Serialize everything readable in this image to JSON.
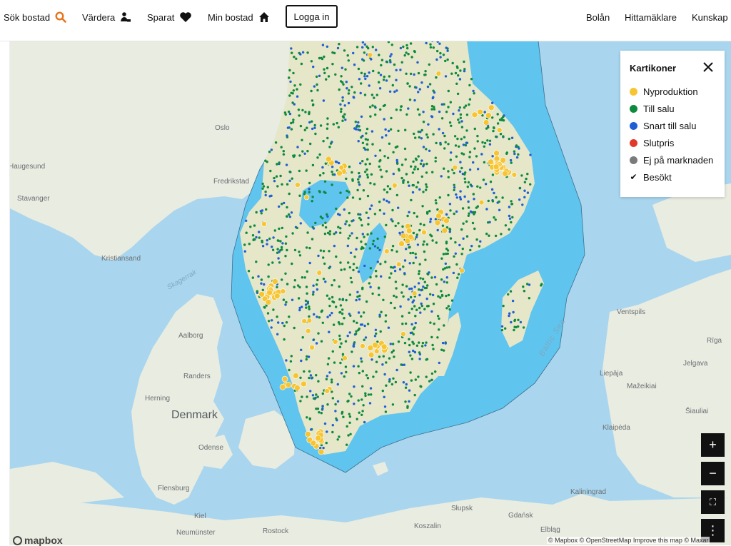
{
  "nav": {
    "items": [
      {
        "label": "Sök bostad",
        "icon": "search-icon"
      },
      {
        "label": "Värdera",
        "icon": "valuation-icon"
      },
      {
        "label": "Sparat",
        "icon": "heart-icon"
      },
      {
        "label": "Min bostad",
        "icon": "home-icon"
      }
    ],
    "login_label": "Logga in",
    "right_items": [
      "Bolån",
      "Hittamäklare",
      "Kunskap"
    ],
    "accent_color": "#e8741c"
  },
  "legend": {
    "title": "Kartikoner",
    "items": [
      {
        "label": "Nyproduktion",
        "color": "#f7c531"
      },
      {
        "label": "Till salu",
        "color": "#0d8a3d"
      },
      {
        "label": "Snart till salu",
        "color": "#1f5fd6"
      },
      {
        "label": "Slutpris",
        "color": "#e2392b"
      },
      {
        "label": "Ej på marknaden",
        "color": "#7a7a7a"
      },
      {
        "label": "Besökt",
        "icon": "check-icon"
      }
    ]
  },
  "map": {
    "places": [
      "Oslo",
      "Fredrikstad",
      "Stavanger",
      "Kristiansand",
      "Haugesund",
      "Aalborg",
      "Randers",
      "Herning",
      "Odense",
      "Flensburg",
      "Kiel",
      "Neumünster",
      "Rostock",
      "Koszalin",
      "Słupsk",
      "Gdańsk",
      "Elbląg",
      "Kaliningrad",
      "Klaipėda",
      "Liepāja",
      "Ventspils",
      "Jelgava",
      "Mažeikiai",
      "Šiauliai",
      "Rīga",
      "Skagerrak"
    ],
    "countries": [
      "Denmark"
    ],
    "seas": [
      "Baltic Sea"
    ],
    "controls": {
      "zoom_in": "+",
      "zoom_out": "−",
      "fullscreen": "⛶",
      "more": "⋮"
    },
    "attribution": "© Mapbox © OpenStreetMap Improve this map © Maxar",
    "logo": "mapbox",
    "land_color": "#e9ece0",
    "sweden_color": "#e6e6c8",
    "water_color": "#a9d6ee",
    "highlight_water_color": "#5fc4ee"
  }
}
